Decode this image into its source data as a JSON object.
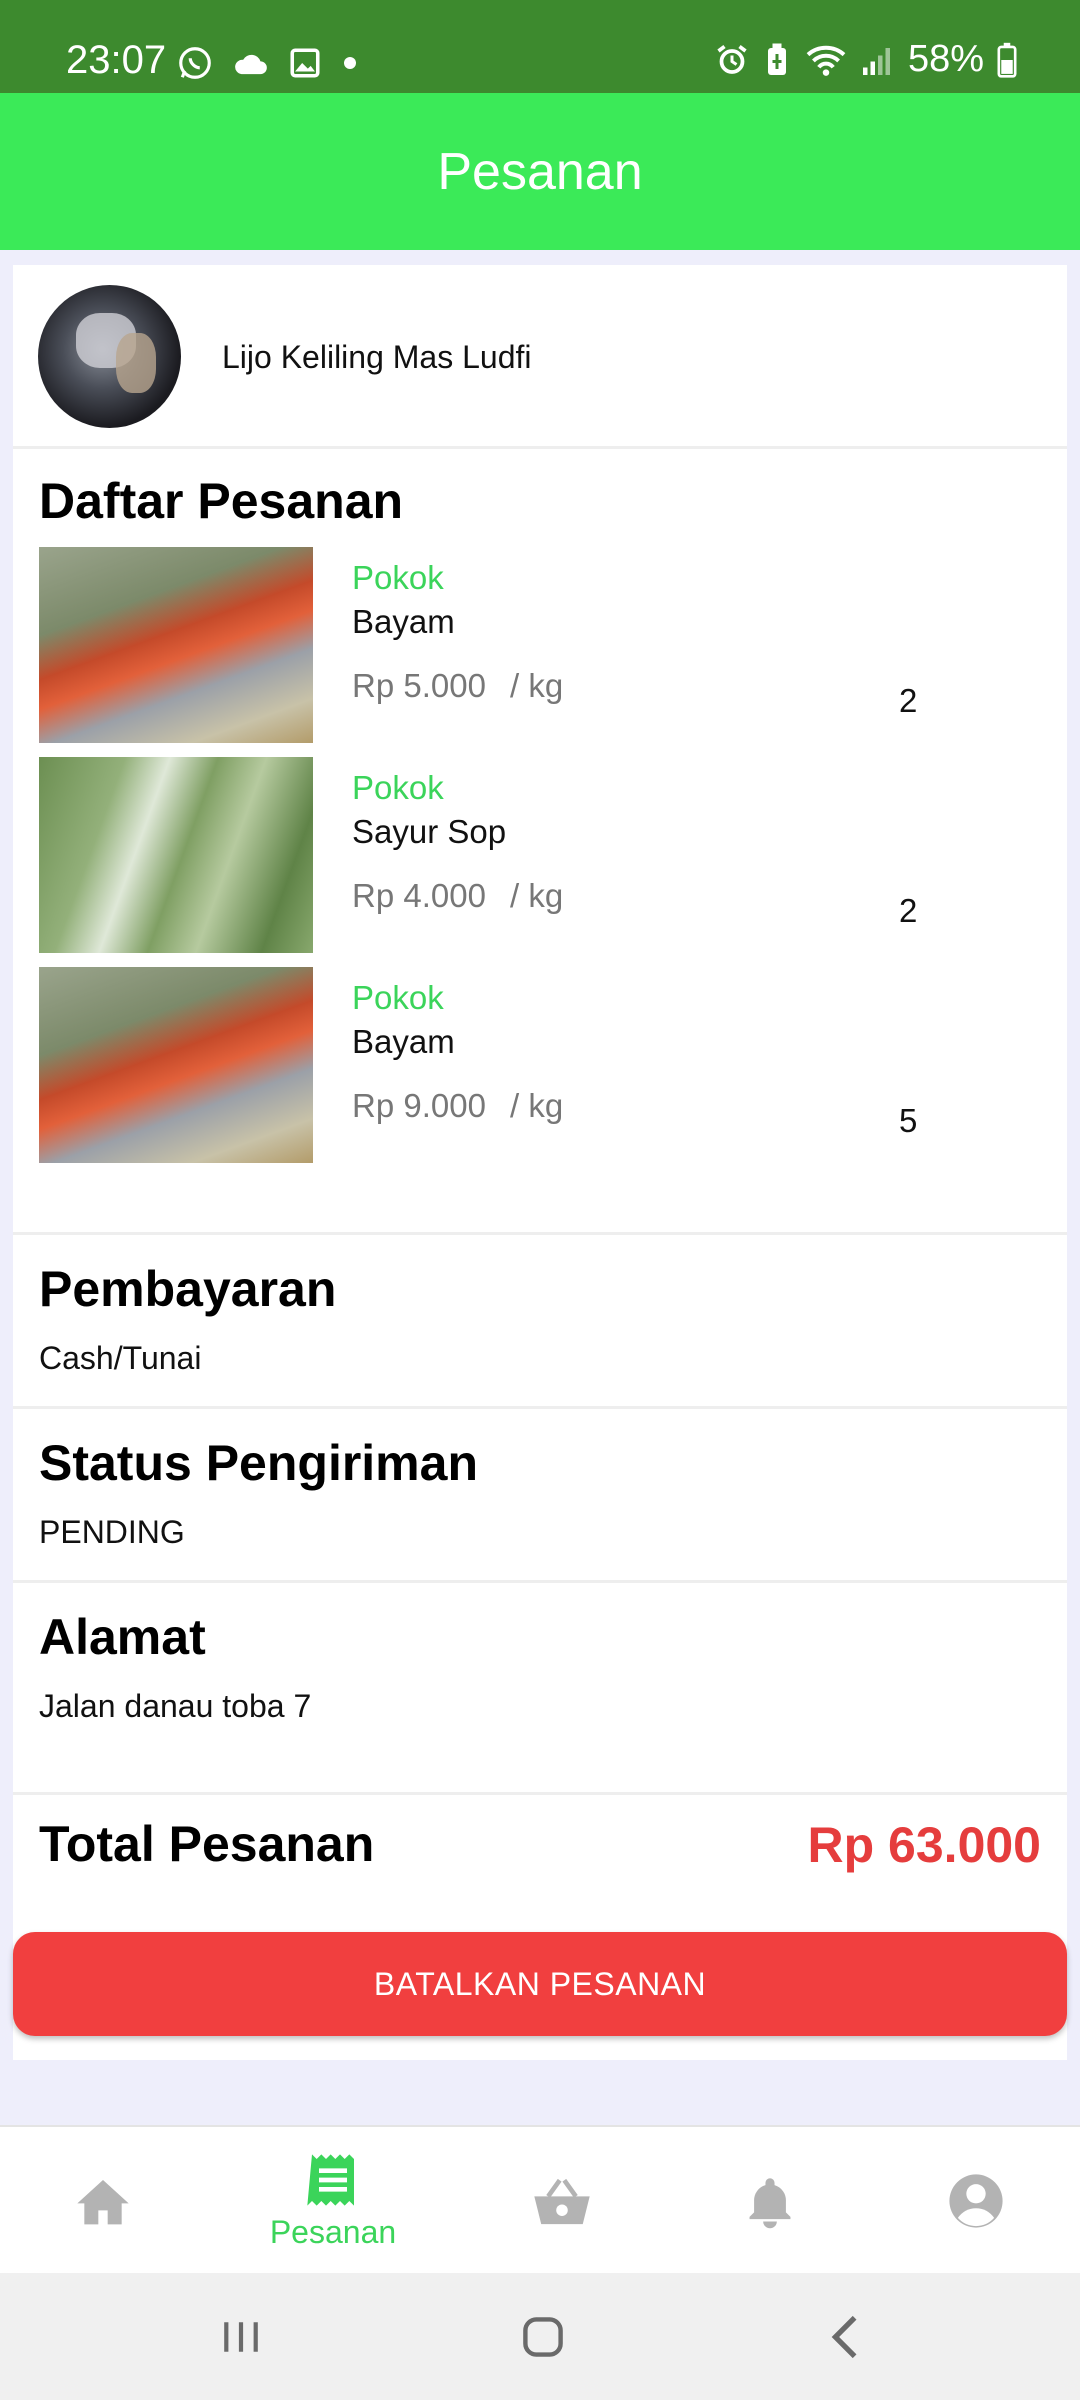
{
  "status_bar": {
    "time": "23:07",
    "battery": "58%",
    "left_icons": [
      "whatsapp-icon",
      "cloud-icon",
      "gallery-icon",
      "dot-icon"
    ],
    "right_icons": [
      "alarm-icon",
      "battery-saver-icon",
      "wifi-icon",
      "signal-icon",
      "battery-icon"
    ]
  },
  "app_bar": {
    "title": "Pesanan"
  },
  "seller": {
    "name": "Lijo Keliling Mas Ludfi"
  },
  "order_list": {
    "title": "Daftar Pesanan",
    "items": [
      {
        "category": "Pokok",
        "name": "Bayam",
        "price": "Rp 5.000",
        "unit": "/ kg",
        "qty": "2"
      },
      {
        "category": "Pokok",
        "name": "Sayur Sop",
        "price": "Rp 4.000",
        "unit": "/ kg",
        "qty": "2"
      },
      {
        "category": "Pokok",
        "name": "Bayam",
        "price": "Rp 9.000",
        "unit": "/ kg",
        "qty": "5"
      }
    ]
  },
  "payment": {
    "title": "Pembayaran",
    "value": "Cash/Tunai"
  },
  "shipping": {
    "title": "Status Pengiriman",
    "value": "PENDING"
  },
  "address": {
    "title": "Alamat",
    "value": "Jalan danau toba 7"
  },
  "total": {
    "label": "Total Pesanan",
    "value": "Rp 63.000"
  },
  "cancel_button": {
    "label": "BATALKAN PESANAN"
  },
  "bottom_nav": {
    "items": [
      {
        "icon": "home-icon",
        "label": ""
      },
      {
        "icon": "receipt-icon",
        "label": "Pesanan",
        "active": true
      },
      {
        "icon": "basket-icon",
        "label": ""
      },
      {
        "icon": "bell-icon",
        "label": ""
      },
      {
        "icon": "account-icon",
        "label": ""
      }
    ]
  },
  "colors": {
    "status_bar": "#3d8a2e",
    "app_bar": "#3bea58",
    "accent_green": "#3bd45a",
    "danger_red": "#f13f3f",
    "total_red": "#e53d3d",
    "nav_inactive": "#b3b3b3"
  }
}
